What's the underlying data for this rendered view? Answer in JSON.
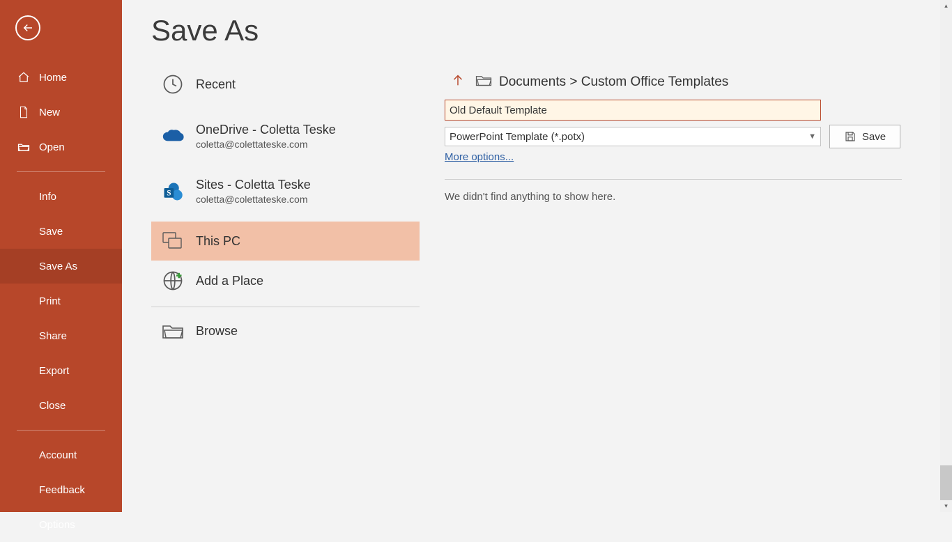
{
  "page_title": "Save As",
  "sidebar": {
    "back_aria": "Back",
    "home": "Home",
    "new": "New",
    "open": "Open",
    "info": "Info",
    "save": "Save",
    "save_as": "Save As",
    "print": "Print",
    "share": "Share",
    "export": "Export",
    "close": "Close",
    "account": "Account",
    "feedback": "Feedback",
    "options": "Options"
  },
  "locations": {
    "recent": "Recent",
    "onedrive": {
      "title": "OneDrive - Coletta Teske",
      "sub": "coletta@colettateske.com"
    },
    "sites": {
      "title": "Sites - Coletta Teske",
      "sub": "coletta@colettateske.com"
    },
    "this_pc": "This PC",
    "add_place": "Add a Place",
    "browse": "Browse"
  },
  "details": {
    "breadcrumb": "Documents > Custom Office Templates",
    "filename": "Old Default Template",
    "filetype": "PowerPoint Template (*.potx)",
    "more_options": "More options...",
    "save_label": "Save",
    "empty_message": "We didn't find anything to show here."
  },
  "colors": {
    "accent": "#b7472a"
  }
}
